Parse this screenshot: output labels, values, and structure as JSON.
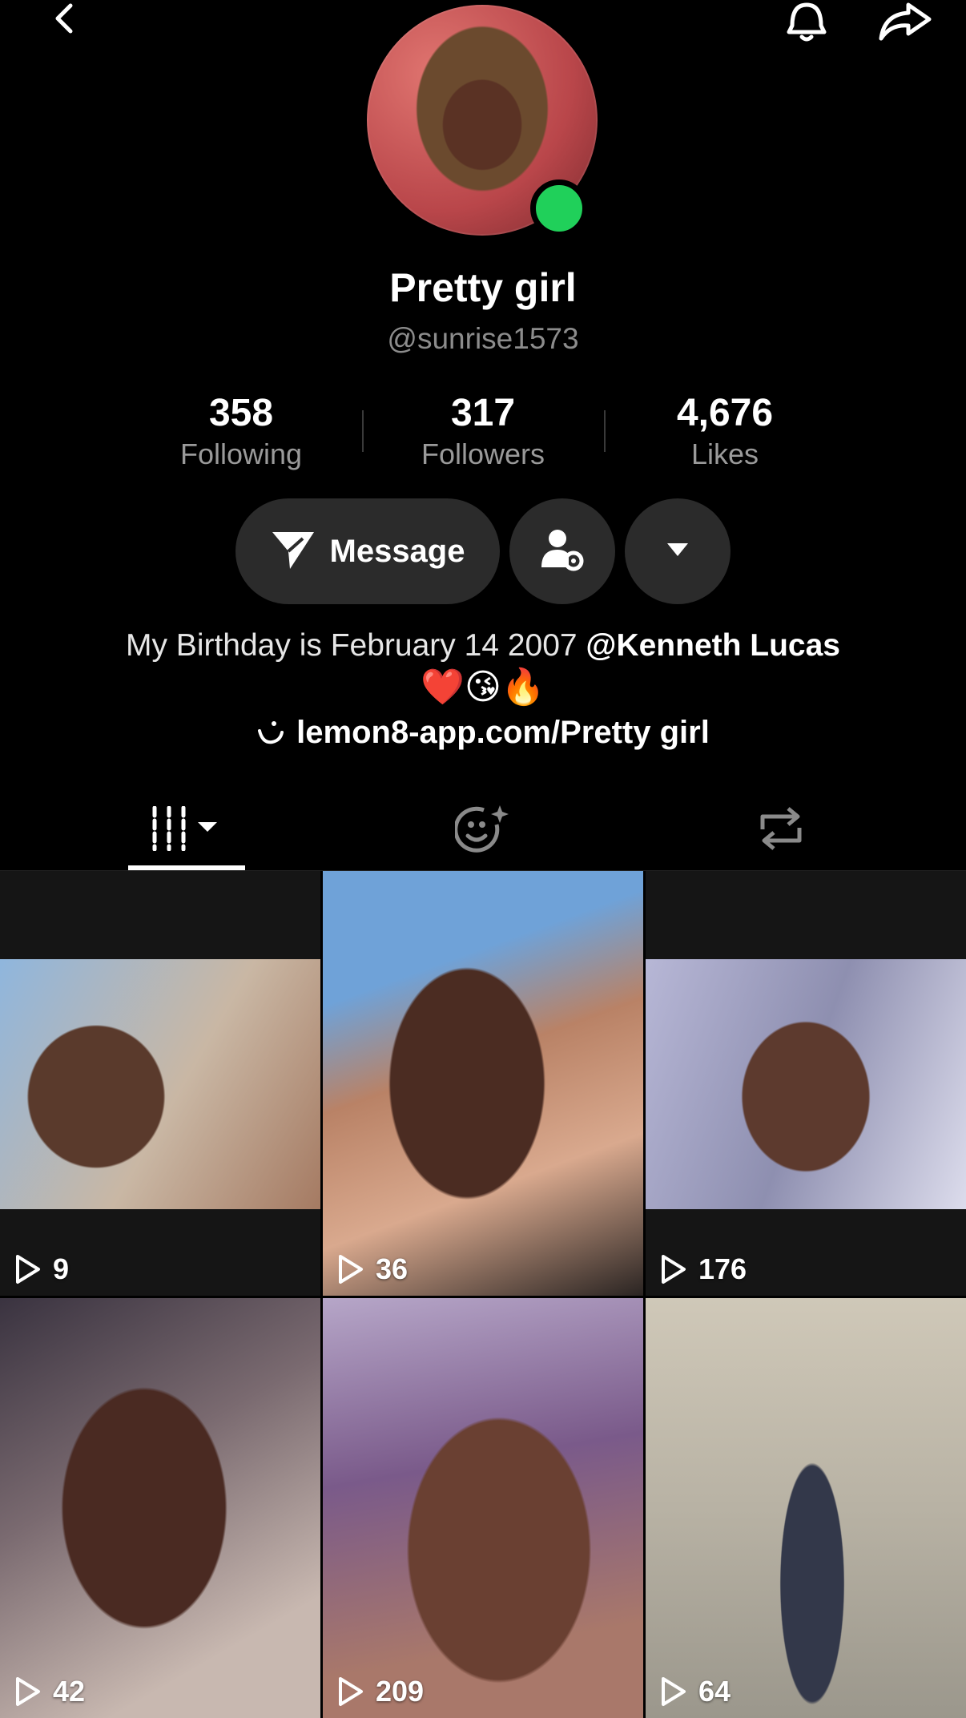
{
  "profile": {
    "display_name": "Pretty girl",
    "handle": "@sunrise1573"
  },
  "stats": [
    {
      "value": "358",
      "label": "Following"
    },
    {
      "value": "317",
      "label": "Followers"
    },
    {
      "value": "4,676",
      "label": "Likes"
    }
  ],
  "actions": {
    "message_label": "Message"
  },
  "bio": {
    "text": "My Birthday is February 14 2007 ",
    "mention": "@Kenneth Lucas",
    "emojis": "❤️😘🔥",
    "link": "lemon8-app.com/Pretty girl"
  },
  "tabs": {
    "active": "videos"
  },
  "videos": [
    {
      "views": "9"
    },
    {
      "views": "36"
    },
    {
      "views": "176"
    },
    {
      "views": "42"
    },
    {
      "views": "209"
    },
    {
      "views": "64"
    }
  ],
  "colors": {
    "background": "#000000",
    "online": "#20d05a",
    "button_bg": "#2b2b2b",
    "muted_text": "#8c8c8c"
  }
}
